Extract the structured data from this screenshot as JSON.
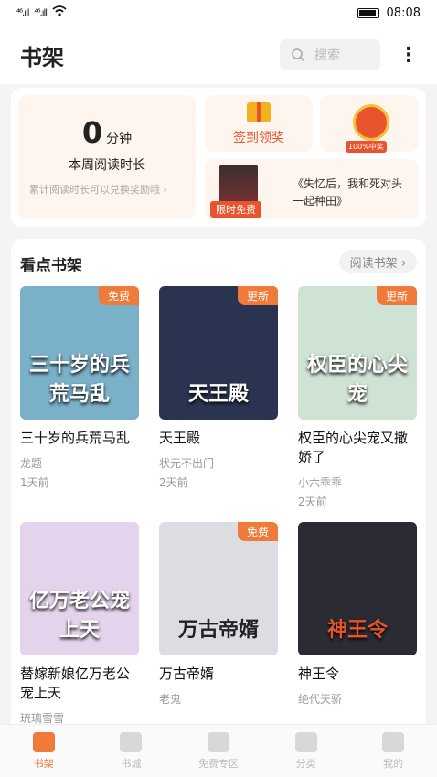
{
  "status_bar": {
    "signal1": "⁴⁶.ıll",
    "signal2": "⁴⁶.ıll",
    "wifi": "wifi-icon",
    "time": "08:08"
  },
  "header": {
    "title": "书架",
    "search_placeholder": "搜索",
    "more": "⋮"
  },
  "reading": {
    "minutes": "0",
    "unit": "分钟",
    "label": "本周阅读时长",
    "sub": "累计阅读时长可以兑换奖励哦 ›"
  },
  "checkin": {
    "label": "签到领奖"
  },
  "prize": {
    "label": "100%中奖"
  },
  "promo": {
    "tag": "限时免费",
    "text": "《失忆后，我和死对头一起种田》"
  },
  "shelf": {
    "title": "看点书架",
    "manage_label": "阅读书架 ›",
    "books": [
      {
        "cover_text": "三十岁的兵荒马乱",
        "badge": "免费",
        "title": "三十岁的兵荒马乱",
        "author": "龙题",
        "time": "1天前",
        "bg": "#7ab0c8"
      },
      {
        "cover_text": "天王殿",
        "badge": "更新",
        "title": "天王殿",
        "author": "状元不出门",
        "time": "2天前",
        "bg": "#2a3450"
      },
      {
        "cover_text": "权臣的心尖宠",
        "badge": "更新",
        "title": "权臣的心尖宠又撒娇了",
        "author": "小六乖乖",
        "time": "2天前",
        "bg": "#cfe3d4"
      },
      {
        "cover_text": "亿万老公宠上天",
        "badge": "",
        "title": "替嫁新娘亿万老公宠上天",
        "author": "琉璃雪雪",
        "time": "",
        "bg": "#e3d3ec"
      },
      {
        "cover_text": "万古帝婿",
        "badge": "免费",
        "title": "万古帝婿",
        "author": "老鬼",
        "time": "",
        "bg": "#dcdde2"
      },
      {
        "cover_text": "神王令",
        "badge": "",
        "title": "神王令",
        "author": "绝代天骄",
        "time": "",
        "bg": "#2b2b33"
      }
    ]
  },
  "tabbar": [
    {
      "label": "书架",
      "icon": "bookshelf-icon",
      "active": true
    },
    {
      "label": "书城",
      "icon": "book-store-icon",
      "active": false
    },
    {
      "label": "免费专区",
      "icon": "free-zone-icon",
      "active": false
    },
    {
      "label": "分类",
      "icon": "category-icon",
      "active": false
    },
    {
      "label": "我的",
      "icon": "profile-icon",
      "active": false
    }
  ],
  "colors": {
    "accent": "#ef7a3a",
    "promo_red": "#e8542e"
  }
}
